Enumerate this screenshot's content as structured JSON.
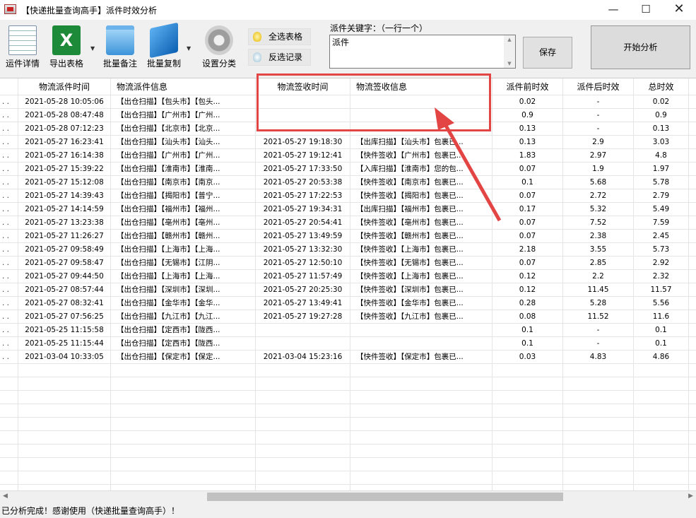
{
  "window": {
    "title": "【快递批量查询高手】派件时效分析",
    "minimize": "—",
    "maximize": "☐",
    "close": "✕"
  },
  "toolbar": {
    "buttons": [
      {
        "label": "运件详情",
        "icon": "document-icon"
      },
      {
        "label": "导出表格",
        "icon": "excel-icon",
        "icon_text": "X"
      },
      {
        "label": "批量备注",
        "icon": "folder-icon"
      },
      {
        "label": "批量复制",
        "icon": "copy-icon"
      },
      {
        "label": "设置分类",
        "icon": "gear-icon"
      }
    ],
    "select_all": "全选表格",
    "invert_select": "反选记录",
    "dropdown_arrow": "▼"
  },
  "keyword": {
    "label": "派件关键字：（一行一个）",
    "value": "派件",
    "scroll_up": "▲",
    "scroll_down": "▼"
  },
  "save_button": "保存",
  "start_button": "开始分析",
  "table": {
    "headers": [
      "",
      "物流派件时间",
      "物流派件信息",
      "物流签收时间",
      "物流签收信息",
      "派件前时效",
      "派件后时效",
      "总时效"
    ],
    "rows": [
      [
        ". .",
        "2021-05-28 10:05:06",
        "【出仓扫描】【包头市】【包头...",
        "",
        "",
        "0.02",
        "-",
        "0.02"
      ],
      [
        ". .",
        "2021-05-28 08:47:48",
        "【出仓扫描】【广州市】【广州...",
        "",
        "",
        "0.9",
        "-",
        "0.9"
      ],
      [
        ". .",
        "2021-05-28 07:12:23",
        "【出仓扫描】【北京市】【北京...",
        "",
        "",
        "0.13",
        "-",
        "0.13"
      ],
      [
        ". .",
        "2021-05-27 16:23:41",
        "【出仓扫描】【汕头市】【汕头...",
        "2021-05-27 19:18:30",
        "【出库扫描】【汕头市】包裹已...",
        "0.13",
        "2.9",
        "3.03"
      ],
      [
        ". .",
        "2021-05-27 16:14:38",
        "【出仓扫描】【广州市】【广州...",
        "2021-05-27 19:12:41",
        "【快件签收】【广州市】包裹已...",
        "1.83",
        "2.97",
        "4.8"
      ],
      [
        ". .",
        "2021-05-27 15:39:22",
        "【出仓扫描】【淮南市】【淮南...",
        "2021-05-27 17:33:50",
        "【入库扫描】【淮南市】您的包...",
        "0.07",
        "1.9",
        "1.97"
      ],
      [
        ". .",
        "2021-05-27 15:12:08",
        "【出仓扫描】【南京市】【南京...",
        "2021-05-27 20:53:38",
        "【快件签收】【南京市】包裹已...",
        "0.1",
        "5.68",
        "5.78"
      ],
      [
        ". .",
        "2021-05-27 14:39:43",
        "【出仓扫描】【揭阳市】【普宁...",
        "2021-05-27 17:22:53",
        "【快件签收】【揭阳市】包裹已...",
        "0.07",
        "2.72",
        "2.79"
      ],
      [
        ". .",
        "2021-05-27 14:14:59",
        "【出仓扫描】【福州市】【福州...",
        "2021-05-27 19:34:31",
        "【出库扫描】【福州市】包裹已...",
        "0.17",
        "5.32",
        "5.49"
      ],
      [
        ". .",
        "2021-05-27 13:23:38",
        "【出仓扫描】【亳州市】【亳州...",
        "2021-05-27 20:54:41",
        "【快件签收】【亳州市】包裹已...",
        "0.07",
        "7.52",
        "7.59"
      ],
      [
        ". .",
        "2021-05-27 11:26:27",
        "【出仓扫描】【赣州市】【赣州...",
        "2021-05-27 13:49:59",
        "【快件签收】【赣州市】包裹已...",
        "0.07",
        "2.38",
        "2.45"
      ],
      [
        ". .",
        "2021-05-27 09:58:49",
        "【出仓扫描】【上海市】【上海...",
        "2021-05-27 13:32:30",
        "【快件签收】【上海市】包裹已...",
        "2.18",
        "3.55",
        "5.73"
      ],
      [
        ". .",
        "2021-05-27 09:58:47",
        "【出仓扫描】【无锡市】【江阴...",
        "2021-05-27 12:50:10",
        "【快件签收】【无锡市】包裹已...",
        "0.07",
        "2.85",
        "2.92"
      ],
      [
        ". .",
        "2021-05-27 09:44:50",
        "【出仓扫描】【上海市】【上海...",
        "2021-05-27 11:57:49",
        "【快件签收】【上海市】包裹已...",
        "0.12",
        "2.2",
        "2.32"
      ],
      [
        ". .",
        "2021-05-27 08:57:44",
        "【出仓扫描】【深圳市】【深圳...",
        "2021-05-27 20:25:30",
        "【快件签收】【深圳市】包裹已...",
        "0.12",
        "11.45",
        "11.57"
      ],
      [
        ". .",
        "2021-05-27 08:32:41",
        "【出仓扫描】【金华市】【金华...",
        "2021-05-27 13:49:41",
        "【快件签收】【金华市】包裹已...",
        "0.28",
        "5.28",
        "5.56"
      ],
      [
        ". .",
        "2021-05-27 07:56:25",
        "【出仓扫描】【九江市】【九江...",
        "2021-05-27 19:27:28",
        "【快件签收】【九江市】包裹已...",
        "0.08",
        "11.52",
        "11.6"
      ],
      [
        ". .",
        "2021-05-25 11:15:58",
        "【出仓扫描】【定西市】【陇西...",
        "",
        "",
        "0.1",
        "-",
        "0.1"
      ],
      [
        ". .",
        "2021-05-25 11:15:44",
        "【出仓扫描】【定西市】【陇西...",
        "",
        "",
        "0.1",
        "-",
        "0.1"
      ],
      [
        ". .",
        "2021-03-04 10:33:05",
        "【出仓扫描】【保定市】【保定...",
        "2021-03-04 15:23:16",
        "【快件签收】【保定市】包裹已...",
        "0.03",
        "4.83",
        "4.86"
      ]
    ],
    "empty_rows": 10
  },
  "scrollbar": {
    "left_arrow": "◀",
    "right_arrow": "▶"
  },
  "status": "已分析完成！感谢使用（快递批量查询高手）！",
  "colors": {
    "annotation": "#e34545",
    "excel": "#1d8a3a"
  }
}
